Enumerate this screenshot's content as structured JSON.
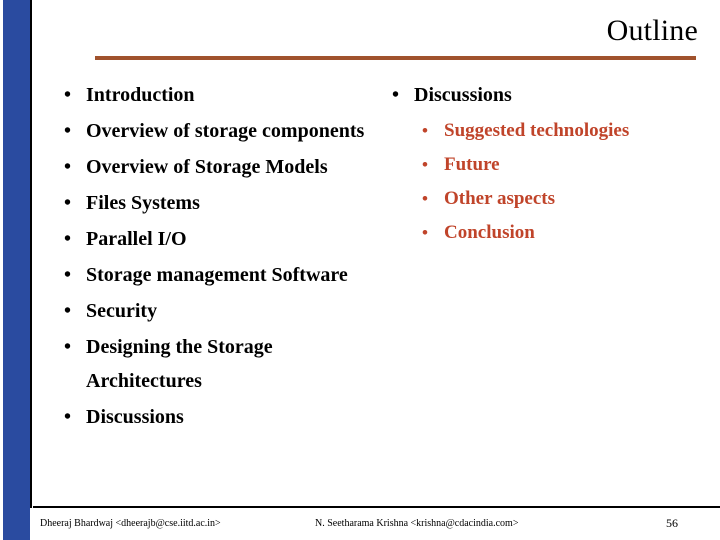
{
  "slide": {
    "title": "Outline",
    "page_number": "56",
    "accent_rule_color": "#A0522D",
    "sidebar_color": "#2A4BA0",
    "subitem_color": "#C0442A"
  },
  "bullet_glyph": "•",
  "left_column": {
    "items": [
      {
        "label": "Introduction"
      },
      {
        "label": "Overview of storage components"
      },
      {
        "label": "Overview of Storage Models"
      },
      {
        "label": "Files Systems"
      },
      {
        "label": "Parallel I/O"
      },
      {
        "label": "Storage management Software"
      },
      {
        "label": "Security"
      },
      {
        "label": "Designing the Storage Architectures"
      },
      {
        "label": "Discussions"
      }
    ]
  },
  "right_column": {
    "items": [
      {
        "label": "Discussions"
      }
    ],
    "subitems": [
      {
        "label": "Suggested technologies"
      },
      {
        "label": "Future"
      },
      {
        "label": "Other aspects"
      },
      {
        "label": "Conclusion"
      }
    ]
  },
  "footer": {
    "left": "Dheeraj Bhardwaj <dheerajb@cse.iitd.ac.in>",
    "center": "N. Seetharama Krishna <krishna@cdacindia.com>"
  }
}
